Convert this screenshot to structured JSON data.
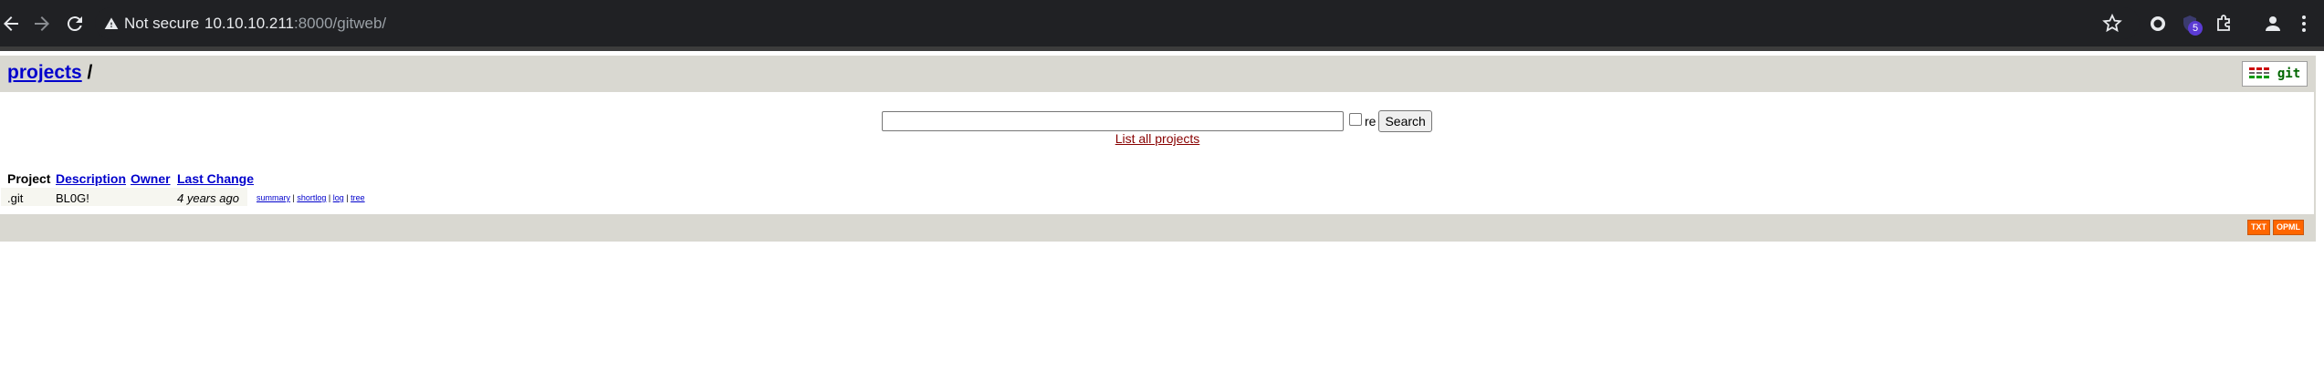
{
  "browser": {
    "security_label": "Not secure",
    "url_host": "10.10.10.211",
    "url_rest": ":8000/gitweb/",
    "extension_badge": "5"
  },
  "header": {
    "projects_link": "projects",
    "separator": "/",
    "logo_text": "git"
  },
  "search": {
    "query": "",
    "regex_label": "re",
    "regex_checked": false,
    "button_label": "Search",
    "list_all_link": "List all projects"
  },
  "table": {
    "columns": [
      "Project",
      "Description",
      "Owner",
      "Last Change"
    ],
    "rows": [
      {
        "project": ".git",
        "description": "BL0G!",
        "owner": "",
        "last_change": "4 years ago",
        "links": [
          "summary",
          "shortlog",
          "log",
          "tree"
        ]
      }
    ]
  },
  "footer": {
    "txt_label": "TXT",
    "opml_label": "OPML"
  },
  "colors": {
    "header_bg": "#d9d8d1",
    "link_blue": "#0000cc",
    "list_all_red": "#880000",
    "feed_orange": "#ff6600"
  }
}
